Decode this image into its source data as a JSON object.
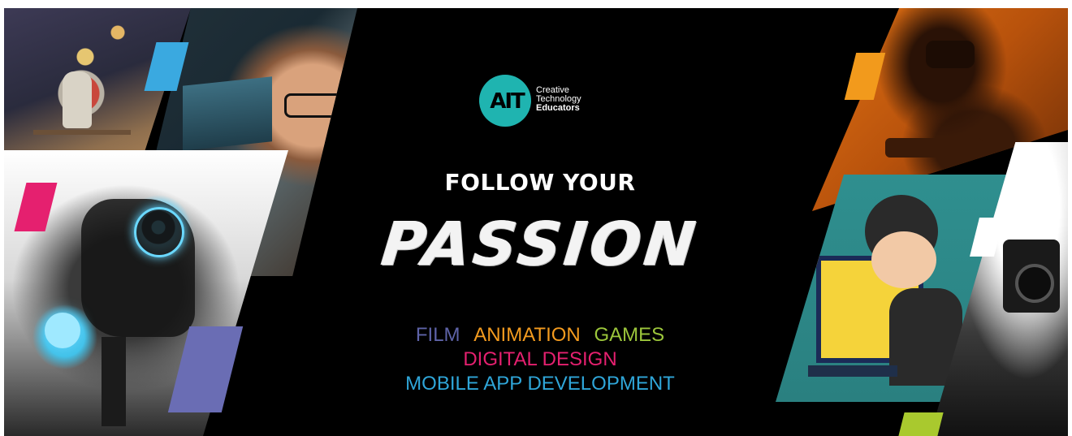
{
  "logo": {
    "mark": "AIT",
    "lines": [
      "Creative",
      "Technology",
      "Educators"
    ]
  },
  "headline": "FOLLOW YOUR",
  "headline_emphasis": "PASSION",
  "disciplines": {
    "film": "FILM",
    "animation": "ANIMATION",
    "games": "GAMES",
    "digital_design": "DIGITAL DESIGN",
    "mobile": "MOBILE APP DEVELOPMENT"
  },
  "colors": {
    "background": "#000000",
    "logo": "#1fb4b0",
    "film": "#5e63a8",
    "animation": "#f39b1f",
    "games": "#9cc63b",
    "digital_design": "#e5206f",
    "mobile": "#2fa6d9",
    "accent_blue": "#3aa9e0",
    "accent_pink": "#e5206f",
    "accent_purple": "#6a6db4",
    "accent_orange": "#f29a1c",
    "accent_lime": "#a9c92e"
  },
  "images": {
    "left_top_1": "astronaut-artwork",
    "left_top_2": "student-at-computer",
    "left_main": "robot-render",
    "right_top": "vr-user-orange",
    "right_middle": "cartoon-burglar",
    "right_bottom": "film-camera"
  }
}
